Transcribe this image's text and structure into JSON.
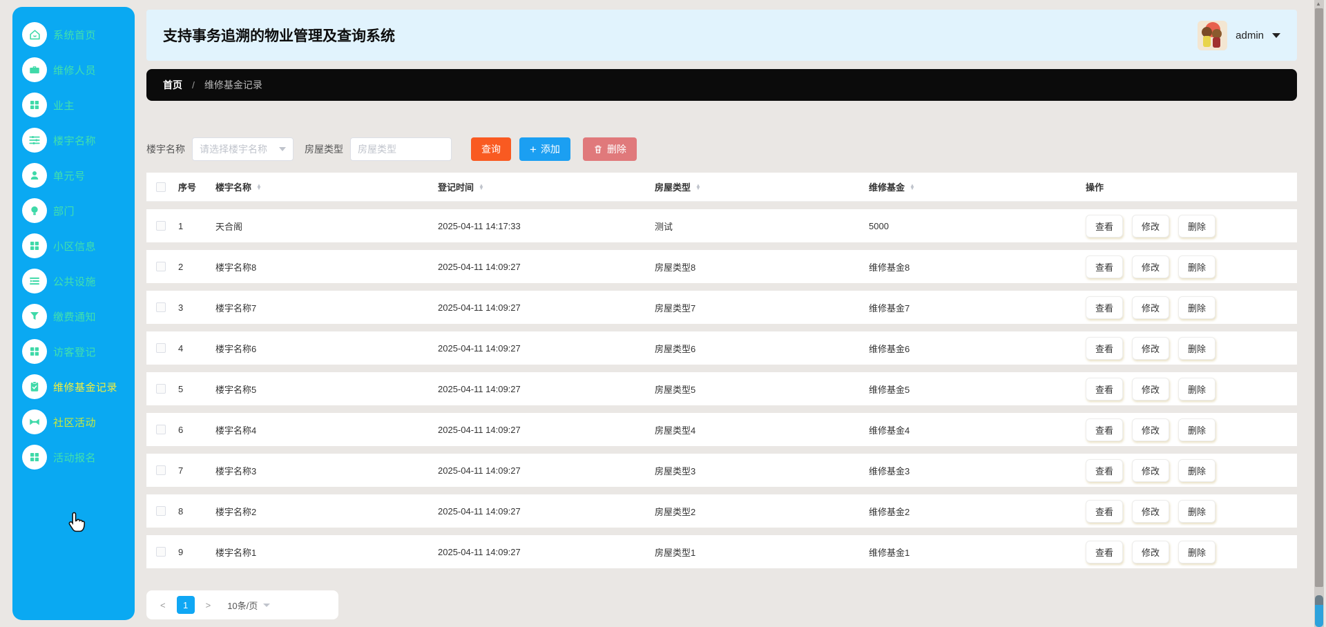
{
  "app": {
    "title": "支持事务追溯的物业管理及查询系统",
    "user": {
      "name": "admin"
    }
  },
  "sidebar": {
    "items": [
      {
        "label": "系统首页",
        "icon": "home-icon",
        "state": "normal"
      },
      {
        "label": "维修人员",
        "icon": "briefcase-icon",
        "state": "normal"
      },
      {
        "label": "业主",
        "icon": "grid-icon",
        "state": "normal"
      },
      {
        "label": "楼宇名称",
        "icon": "sliders-icon",
        "state": "normal"
      },
      {
        "label": "单元号",
        "icon": "user-icon",
        "state": "normal"
      },
      {
        "label": "部门",
        "icon": "lightbulb-icon",
        "state": "normal"
      },
      {
        "label": "小区信息",
        "icon": "grid-icon",
        "state": "normal"
      },
      {
        "label": "公共设施",
        "icon": "list-icon",
        "state": "normal"
      },
      {
        "label": "缴费通知",
        "icon": "funnel-icon",
        "state": "normal"
      },
      {
        "label": "访客登记",
        "icon": "grid-icon",
        "state": "normal"
      },
      {
        "label": "维修基金记录",
        "icon": "clipboard-check-icon",
        "state": "active"
      },
      {
        "label": "社区活动",
        "icon": "ticket-icon",
        "state": "hover"
      },
      {
        "label": "活动报名",
        "icon": "grid-icon",
        "state": "normal"
      }
    ]
  },
  "breadcrumb": {
    "home": "首页",
    "separator": "/",
    "current": "维修基金记录"
  },
  "filters": {
    "building_label": "楼宇名称",
    "building_placeholder": "请选择楼宇名称",
    "house_type_label": "房屋类型",
    "house_type_placeholder": "房屋类型",
    "query_label": "查询",
    "add_label": "添加",
    "delete_label": "删除"
  },
  "table": {
    "columns": [
      {
        "label": "序号",
        "sortable": false
      },
      {
        "label": "楼宇名称",
        "sortable": true
      },
      {
        "label": "登记时间",
        "sortable": true
      },
      {
        "label": "房屋类型",
        "sortable": true
      },
      {
        "label": "维修基金",
        "sortable": true
      },
      {
        "label": "操作",
        "sortable": false
      }
    ],
    "rows": [
      {
        "index": "1",
        "building": "天合阁",
        "time": "2025-04-11 14:17:33",
        "house_type": "测试",
        "fund": "5000"
      },
      {
        "index": "2",
        "building": "楼宇名称8",
        "time": "2025-04-11 14:09:27",
        "house_type": "房屋类型8",
        "fund": "维修基金8"
      },
      {
        "index": "3",
        "building": "楼宇名称7",
        "time": "2025-04-11 14:09:27",
        "house_type": "房屋类型7",
        "fund": "维修基金7"
      },
      {
        "index": "4",
        "building": "楼宇名称6",
        "time": "2025-04-11 14:09:27",
        "house_type": "房屋类型6",
        "fund": "维修基金6"
      },
      {
        "index": "5",
        "building": "楼宇名称5",
        "time": "2025-04-11 14:09:27",
        "house_type": "房屋类型5",
        "fund": "维修基金5"
      },
      {
        "index": "6",
        "building": "楼宇名称4",
        "time": "2025-04-11 14:09:27",
        "house_type": "房屋类型4",
        "fund": "维修基金4"
      },
      {
        "index": "7",
        "building": "楼宇名称3",
        "time": "2025-04-11 14:09:27",
        "house_type": "房屋类型3",
        "fund": "维修基金3"
      },
      {
        "index": "8",
        "building": "楼宇名称2",
        "time": "2025-04-11 14:09:27",
        "house_type": "房屋类型2",
        "fund": "维修基金2"
      },
      {
        "index": "9",
        "building": "楼宇名称1",
        "time": "2025-04-11 14:09:27",
        "house_type": "房屋类型1",
        "fund": "维修基金1"
      }
    ],
    "actions": [
      "查看",
      "修改",
      "删除"
    ]
  },
  "pagination": {
    "prev": "<",
    "page": "1",
    "next": ">",
    "page_size": "10条/页"
  },
  "colors": {
    "sidebar_bg": "#0aa9f2",
    "sidebar_text": "#43e0ac",
    "sidebar_active_text": "#f2ee3e",
    "sidebar_hover_text": "#c8e83d",
    "titlebar_bg": "#e1f3fd",
    "breadcrumb_bg": "#0b0b0b",
    "query_btn": "#f95a21",
    "add_btn": "#1b9ff2",
    "delete_btn": "#e0797b",
    "page_active": "#10a7f4",
    "page_bg": "#eae7e4"
  }
}
